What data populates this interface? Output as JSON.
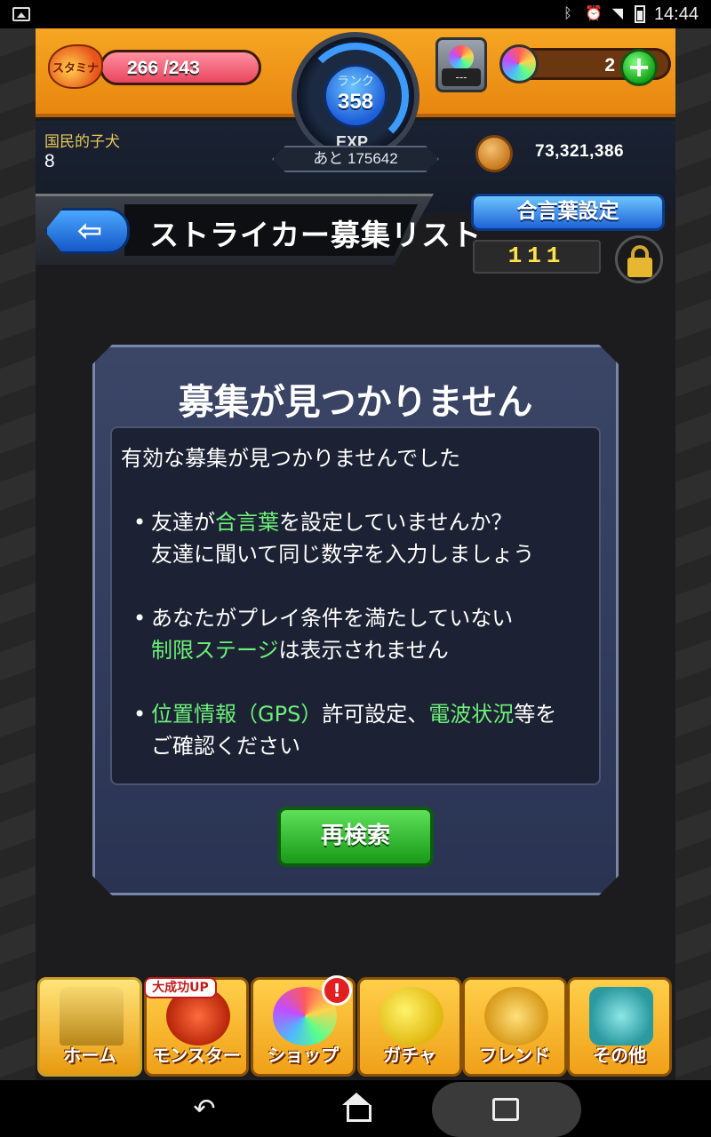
{
  "status_bar": {
    "time": "14:44",
    "icons": [
      "image-icon",
      "bluetooth-icon",
      "alarm-icon",
      "wifi-icon",
      "battery-icon"
    ]
  },
  "header": {
    "stamina_label": "スタミナ",
    "stamina_value": "266 /243",
    "stamina_fill_fraction": 1.0,
    "rank_label": "ランク",
    "rank_value": "358",
    "exp_label": "EXP",
    "exp_remaining": "あと 175642",
    "box_label": "---",
    "orb_count": "2",
    "player_name": "国民的子犬",
    "player_level": "8",
    "coins": "73,321,386"
  },
  "page": {
    "title": "ストライカー募集リスト",
    "passcode_button": "合言葉設定",
    "passcode_value": "111"
  },
  "dialog": {
    "title": "募集が見つかりません",
    "lead": "有効な募集が見つかりませんでした",
    "bullet1": {
      "a": "友達が",
      "hl": "合言葉",
      "b": "を設定していませんか？",
      "line2": "友達に聞いて同じ数字を入力しましょう"
    },
    "bullet2": {
      "line1": "あなたがプレイ条件を満たしていない",
      "hl": "制限ステージ",
      "b": "は表示されません"
    },
    "bullet3": {
      "hl1": "位置情報（GPS）",
      "a": "許可設定、",
      "hl2": "電波状況",
      "b": "等を",
      "line2": "ご確認ください"
    },
    "retry_button": "再検索"
  },
  "bottom_nav": {
    "home": "ホーム",
    "monster": "モンスター",
    "monster_badge": "大成功UP",
    "shop": "ショップ",
    "shop_badge": "!",
    "gacha": "ガチャ",
    "friend": "フレンド",
    "other": "その他"
  },
  "colors": {
    "header_orange": "#f6a623",
    "highlight_green": "#6df07a",
    "button_blue": "#1e63d6",
    "button_green": "#189a18",
    "dialog_bg": "#3b4667"
  }
}
